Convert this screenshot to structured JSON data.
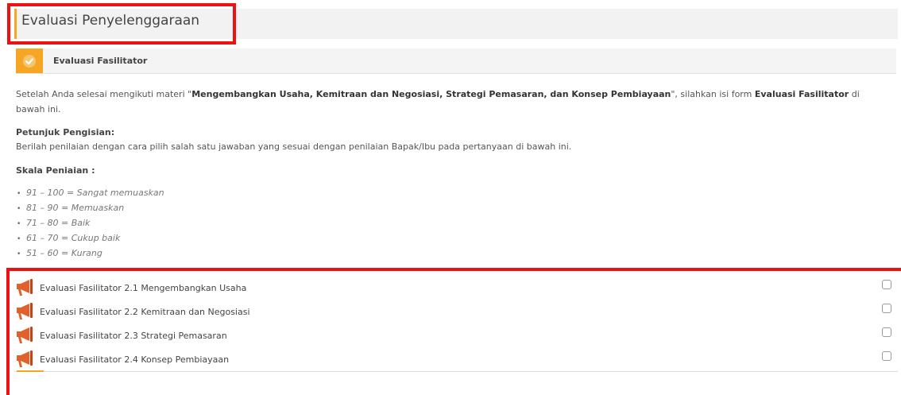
{
  "section": {
    "title": "Evaluasi Penyelenggaraan"
  },
  "activity": {
    "title": "Evaluasi Fasilitator"
  },
  "intro": {
    "prefix": "Setelah Anda selesai mengikuti materi \"",
    "materi": "Mengembangkan Usaha, Kemitraan dan Negosiasi, Strategi Pemasaran, dan Konsep Pembiayaan",
    "middle": "\", silahkan isi form ",
    "form_name": "Evaluasi Fasilitator",
    "suffix": " di",
    "line2": "bawah ini."
  },
  "petunjuk": {
    "label": "Petunjuk Pengisian:",
    "text": "Berilah penilaian dengan cara pilih salah satu jawaban yang sesuai dengan penilaian Bapak/Ibu pada pertanyaan di bawah ini."
  },
  "skala": {
    "label": "Skala Peniaian :",
    "items": [
      "91 – 100 = Sangat memuaskan",
      "81 – 90  = Memuaskan",
      "71 – 80  = Baik",
      "61 – 70  = Cukup baik",
      "51 – 60  = Kurang"
    ]
  },
  "evaluations": [
    {
      "label": "Evaluasi Fasilitator 2.1 Mengembangkan Usaha"
    },
    {
      "label": "Evaluasi Fasilitator 2.2 Kemitraan dan Negosiasi"
    },
    {
      "label": "Evaluasi Fasilitator 2.3 Strategi Pemasaran"
    },
    {
      "label": "Evaluasi Fasilitator 2.4 Konsep Pembiayaan"
    }
  ],
  "colors": {
    "accent": "#f5a623",
    "highlight": "#ee1111",
    "megaphone": "#e2612b"
  },
  "icons": {
    "badge": "check-icon",
    "activity": "megaphone-icon",
    "completion": "checkbox-icon"
  }
}
